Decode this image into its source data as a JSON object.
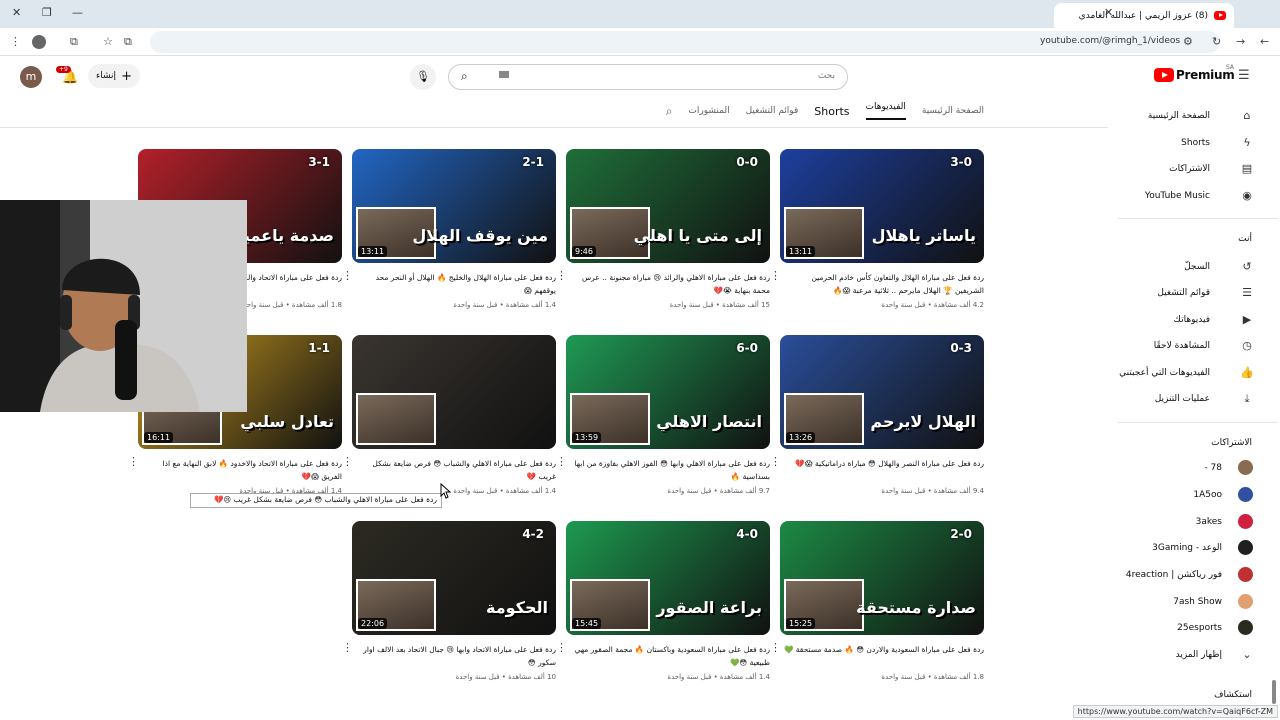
{
  "browser": {
    "tab_title": "(8) عزوز الريمي | عبدالله الغامدي",
    "url": "youtube.com/@rimgh_1/videos",
    "status_url": "https://www.youtube.com/watch?v=QaiqF6cf-ZM"
  },
  "header": {
    "search_placeholder": "بحث",
    "create_label": "إنشاء",
    "notif_count": "+9",
    "premium_label": "Premium",
    "region": "SA",
    "avatar_letter": "m"
  },
  "channel_tabs": [
    "الصفحة الرئيسية",
    "الفيديوهات",
    "Shorts",
    "قوائم التشغيل",
    "المنشورات"
  ],
  "sidebar": {
    "top": [
      {
        "label": "الصفحة الرئيسية",
        "icon": "home-icon",
        "glyph": "⌂"
      },
      {
        "label": "Shorts",
        "icon": "shorts-icon",
        "glyph": "ϟ"
      },
      {
        "label": "الاشتراكات",
        "icon": "subscriptions-icon",
        "glyph": "▤"
      },
      {
        "label": "YouTube Music",
        "icon": "music-icon",
        "glyph": "◉"
      }
    ],
    "you_label": "أنت",
    "you": [
      {
        "label": "السجلّ",
        "icon": "history-icon",
        "glyph": "↺"
      },
      {
        "label": "قوائم التشغيل",
        "icon": "playlists-icon",
        "glyph": "☰"
      },
      {
        "label": "فيديوهاتك",
        "icon": "your-videos-icon",
        "glyph": "▶"
      },
      {
        "label": "المشاهدة لاحقًا",
        "icon": "watch-later-icon",
        "glyph": "◷"
      },
      {
        "label": "الفيديوهات التي أعجبتني",
        "icon": "like-icon",
        "glyph": "👍"
      },
      {
        "label": "عمليات التنزيل",
        "icon": "download-icon",
        "glyph": "⤓"
      }
    ],
    "subs_label": "الاشتراكات",
    "subs": [
      {
        "name": "78 -",
        "color": "#8a6a50"
      },
      {
        "name": "1A5oo",
        "color": "#3050a0"
      },
      {
        "name": "3akes",
        "color": "#d02040"
      },
      {
        "name": "الوعد - 3Gaming",
        "color": "#202020"
      },
      {
        "name": "فور رياكشن | 4reaction",
        "color": "#c03030"
      },
      {
        "name": "7ash Show",
        "color": "#e0a070"
      },
      {
        "name": "25esports",
        "color": "#2a2a20"
      }
    ],
    "show_more": "إظهار المزيد",
    "explore": "استكشاف"
  },
  "videos": [
    {
      "title": "ردة فعل على مباراة الهلال والتعاون كأس خادم الحرمين الشريفين 🏆 الهلال مايرحم .. ثلاثية مرعبة 😱🔥",
      "stats": "4.2 ألف مشاهدة • قبل سنة واحدة",
      "duration": "13:11",
      "score": "3-0",
      "big": "ياساتر ياهلال",
      "bg": "#1d3f9e"
    },
    {
      "title": "ردة فعل على مباراة الاهلي والرائد 😢 مباراة مجنونة .. عرس محمة بنهاية 😭💔",
      "stats": "15 ألف مشاهدة • قبل سنة واحدة",
      "duration": "9:46",
      "score": "0-0",
      "big": "إلى متى يا اهلي",
      "bg": "#1f6f3a"
    },
    {
      "title": "ردة فعل على مباراة الهلال والخليج 🔥 الهلال أو النحر محد يوقفهم 😱",
      "stats": "1.4 ألف مشاهدة • قبل سنة واحدة",
      "duration": "13:11",
      "score": "2-1",
      "big": "مين يوقف الهلال",
      "bg": "#2266c4"
    },
    {
      "title": "ردة فعل على مباراة الاتحاد والخليج 🔥 صدمة ياعميد",
      "stats": "1.8 ألف مشاهدة • قبل سنة واحدة",
      "duration": "",
      "score": "3-1",
      "big": "صدمة ياعميد",
      "bg": "#b3202a"
    },
    {
      "title": "ردة فعل على مباراة النصر والهلال 😳 مباراة دراماتيكية 😱💔",
      "stats": "9.4 ألف مشاهدة • قبل سنة واحدة",
      "duration": "13:26",
      "score": "0-3",
      "big": "الهلال لايرحم",
      "bg": "#2a4e9a"
    },
    {
      "title": "ردة فعل على مباراة الاهلي وابها 😳 الفوز الاهلي بفاوزة من ابها بسداسية 🔥",
      "stats": "9.7 ألف مشاهدة • قبل سنة واحدة",
      "duration": "13:59",
      "score": "6-0",
      "big": "انتصار الاهلي",
      "bg": "#1f9a55"
    },
    {
      "title": "ردة فعل على مباراة الاهلي والشباب 😳 فرص ضايعة بشكل غريب 💔",
      "stats": "1.4 ألف مشاهدة • قبل سنة واحدة",
      "duration": "",
      "score": "",
      "big": "",
      "bg": "#3a3530"
    },
    {
      "title": "ردة فعل على مباراة الاتحاد والاخدود 🔥 لابق النهاية مع اذا الفريق 😱💔",
      "stats": "1.4 ألف مشاهدة • قبل سنة واحدة",
      "duration": "16:11",
      "score": "1-1",
      "big": "تعادل سلبي",
      "bg": "#c89a20"
    },
    {
      "title": "ردة فعل على مباراة السعودية والاردن 😳 🔥 صدمة مستحقة 💚",
      "stats": "1.8 ألف مشاهدة • قبل سنة واحدة",
      "duration": "15:25",
      "score": "2-0",
      "big": "صدارة مستحقة",
      "bg": "#1c8a45"
    },
    {
      "title": "ردة فعل على مباراة السعودية وباكستان 🔥 مجمة الصقور مهي طبيعية 😳💚",
      "stats": "1.4 ألف مشاهدة • قبل سنة واحدة",
      "duration": "15:45",
      "score": "4-0",
      "big": "براعة الصقور",
      "bg": "#1d9a50"
    },
    {
      "title": "ردة فعل على مباراة الاتحاد وابها 😢 جبال الاتحاد بعد الالف اوار سكور 😳",
      "stats": "10 ألف مشاهدة • قبل سنة واحدة",
      "duration": "22:06",
      "score": "4-2",
      "big": "الحكومة",
      "bg": "#2c2a22"
    }
  ],
  "tooltip": "ردة فعل على مباراة الاهلي والشباب 😳 فرص ضايعة بشكل غريب 😢💔"
}
